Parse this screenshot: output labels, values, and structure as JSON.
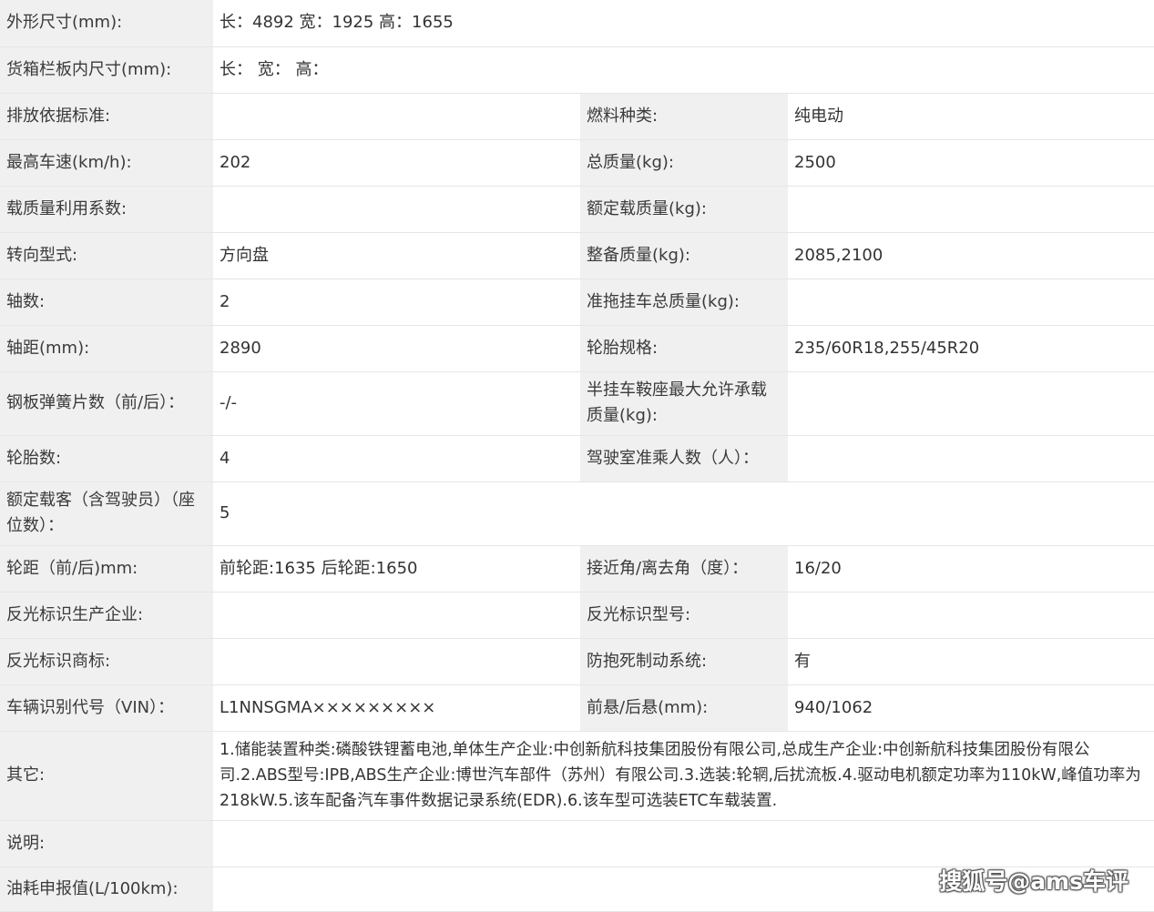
{
  "rows": [
    {
      "label": "外形尺寸(mm):",
      "value": "长：4892 宽：1925 高：1655"
    },
    {
      "label": "货箱栏板内尺寸(mm):",
      "value": "长： 宽： 高："
    },
    {
      "label": "排放依据标准:",
      "value": "",
      "label2": "燃料种类:",
      "value2": "纯电动"
    },
    {
      "label": "最高车速(km/h):",
      "value": "202",
      "label2": "总质量(kg):",
      "value2": "2500"
    },
    {
      "label": "载质量利用系数:",
      "value": "",
      "label2": "额定载质量(kg):",
      "value2": ""
    },
    {
      "label": "转向型式:",
      "value": "方向盘",
      "label2": "整备质量(kg):",
      "value2": "2085,2100"
    },
    {
      "label": "轴数:",
      "value": "2",
      "label2": "准拖挂车总质量(kg):",
      "value2": ""
    },
    {
      "label": "轴距(mm):",
      "value": "2890",
      "label2": "轮胎规格:",
      "value2": "235/60R18,255/45R20"
    },
    {
      "label": "钢板弹簧片数（前/后）：",
      "value": "-/-",
      "label2": "半挂车鞍座最大允许承载质量(kg):",
      "value2": ""
    },
    {
      "label": "轮胎数:",
      "value": "4",
      "label2": "驾驶室准乘人数（人）：",
      "value2": ""
    },
    {
      "label": "额定载客（含驾驶员）（座位数）：",
      "value": "5"
    },
    {
      "label": "轮距（前/后)mm:",
      "value": "前轮距:1635 后轮距:1650",
      "label2": "接近角/离去角（度）：",
      "value2": "16/20"
    },
    {
      "label": "反光标识生产企业:",
      "value": "",
      "label2": "反光标识型号:",
      "value2": ""
    },
    {
      "label": "反光标识商标:",
      "value": "",
      "label2": "防抱死制动系统:",
      "value2": "有"
    },
    {
      "label": "车辆识别代号（VIN）：",
      "value": "L1NNSGMA×××××××××",
      "label2": "前悬/后悬(mm):",
      "value2": "940/1062"
    },
    {
      "label": "其它:",
      "value": "1.储能装置种类:磷酸铁锂蓄电池,单体生产企业:中创新航科技集团股份有限公司,总成生产企业:中创新航科技集团股份有限公司.2.ABS型号:IPB,ABS生产企业:博世汽车部件（苏州）有限公司.3.选装:轮辋,后扰流板.4.驱动电机额定功率为110kW,峰值功率为218kW.5.该车配备汽车事件数据记录系统(EDR).6.该车型可选装ETC车载装置."
    },
    {
      "label": "说明:",
      "value": ""
    },
    {
      "label": "油耗申报值(L/100km):",
      "value": ""
    }
  ],
  "watermark": "搜狐号@ams车评"
}
